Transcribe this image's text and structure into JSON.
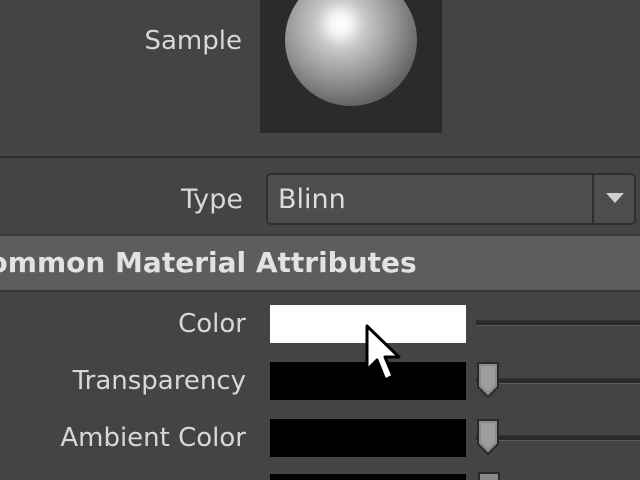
{
  "sample": {
    "label": "Sample"
  },
  "type": {
    "label": "Type",
    "value": "Blinn"
  },
  "section": {
    "title": "Common Material Attributes"
  },
  "attributes": [
    {
      "label": "Color",
      "swatch_color": "#ffffff",
      "slider_value": 1.0
    },
    {
      "label": "Transparency",
      "swatch_color": "#000000",
      "slider_value": 0.0
    },
    {
      "label": "Ambient Color",
      "swatch_color": "#000000",
      "slider_value": 0.0
    }
  ],
  "colors": {
    "panel_bg": "#444444",
    "header_bg": "#5d5d5d",
    "field_bg": "#4d4d4d"
  },
  "icons": {
    "dropdown": "chevron-down-icon",
    "cursor": "mouse-pointer-icon"
  }
}
